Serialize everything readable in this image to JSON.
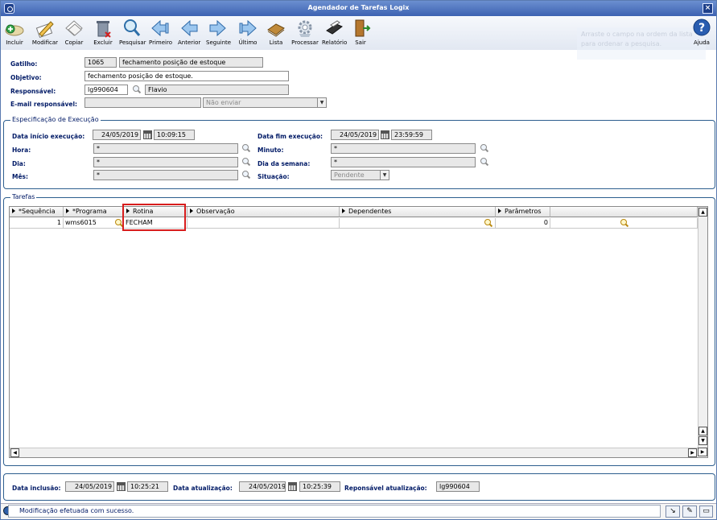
{
  "window": {
    "title": "Agendador de Tarefas Logix"
  },
  "toolbar": {
    "buttons": [
      {
        "label": "Incluir",
        "icon": "add-disc-icon"
      },
      {
        "label": "Modificar",
        "icon": "pencil-icon"
      },
      {
        "label": "Copiar",
        "icon": "copy-pages-icon"
      },
      {
        "label": "Excluir",
        "icon": "trash-icon"
      },
      {
        "label": "Pesquisar",
        "icon": "magnifier-icon"
      },
      {
        "label": "Primeiro",
        "icon": "first-arrow-icon"
      },
      {
        "label": "Anterior",
        "icon": "previous-arrow-icon"
      },
      {
        "label": "Seguinte",
        "icon": "next-arrow-icon"
      },
      {
        "label": "Último",
        "icon": "last-arrow-icon"
      },
      {
        "label": "Lista",
        "icon": "book-list-icon"
      },
      {
        "label": "Processar",
        "icon": "gear-process-icon"
      },
      {
        "label": "Relatório",
        "icon": "printer-icon"
      },
      {
        "label": "Sair",
        "icon": "exit-door-icon"
      }
    ],
    "help_label": "Ajuda",
    "ghost_text": "Arraste o campo na ordem da lista  para ordenar a pesquisa."
  },
  "header": {
    "gatilho_label": "Gatilho:",
    "gatilho_code": "1065",
    "gatilho_desc": "fechamento posição de estoque",
    "objetivo_label": "Objetivo:",
    "objetivo_value": "fechamento posição de estoque.",
    "responsavel_label": "Responsável:",
    "responsavel_code": "lg990604",
    "responsavel_name": "Flavio",
    "email_label": "E-mail responsável:",
    "email_value": "",
    "email_option": "Não enviar"
  },
  "execucao": {
    "group_title": "Especificação de Execução",
    "data_inicio_label": "Data início execução:",
    "data_inicio": "24/05/2019",
    "hora_inicio": "10:09:15",
    "data_fim_label": "Data fim execução:",
    "data_fim": "24/05/2019",
    "hora_fim": "23:59:59",
    "hora_label": "Hora:",
    "hora_value": "*",
    "minuto_label": "Minuto:",
    "minuto_value": "*",
    "dia_label": "Dia:",
    "dia_value": "*",
    "dia_semana_label": "Dia da semana:",
    "dia_semana_value": "*",
    "mes_label": "Mês:",
    "mes_value": "*",
    "situacao_label": "Situação:",
    "situacao_value": "Pendente"
  },
  "tarefas": {
    "group_title": "Tarefas",
    "columns": [
      "*Sequência",
      "*Programa",
      "Rotina",
      "Observação",
      "Dependentes",
      "Parâmetros"
    ],
    "rows": [
      {
        "sequencia": "1",
        "programa": "wms6015",
        "rotina": "FECHAM",
        "observacao": "",
        "dependentes": "",
        "parametros": "0"
      }
    ]
  },
  "footer": {
    "data_inclusao_label": "Data inclusão:",
    "data_inclusao": "24/05/2019",
    "hora_inclusao": "10:25:21",
    "data_atualizacao_label": "Data atualização:",
    "data_atualizacao": "24/05/2019",
    "hora_atualizacao": "10:25:39",
    "resp_atualizacao_label": "Reponsável atualização:",
    "resp_atualizacao": "lg990604"
  },
  "status": {
    "message": "Modificação efetuada com sucesso."
  },
  "colors": {
    "title_bar": "#3d62b2",
    "label_text": "#001a66",
    "highlight": "#d81d1d"
  }
}
